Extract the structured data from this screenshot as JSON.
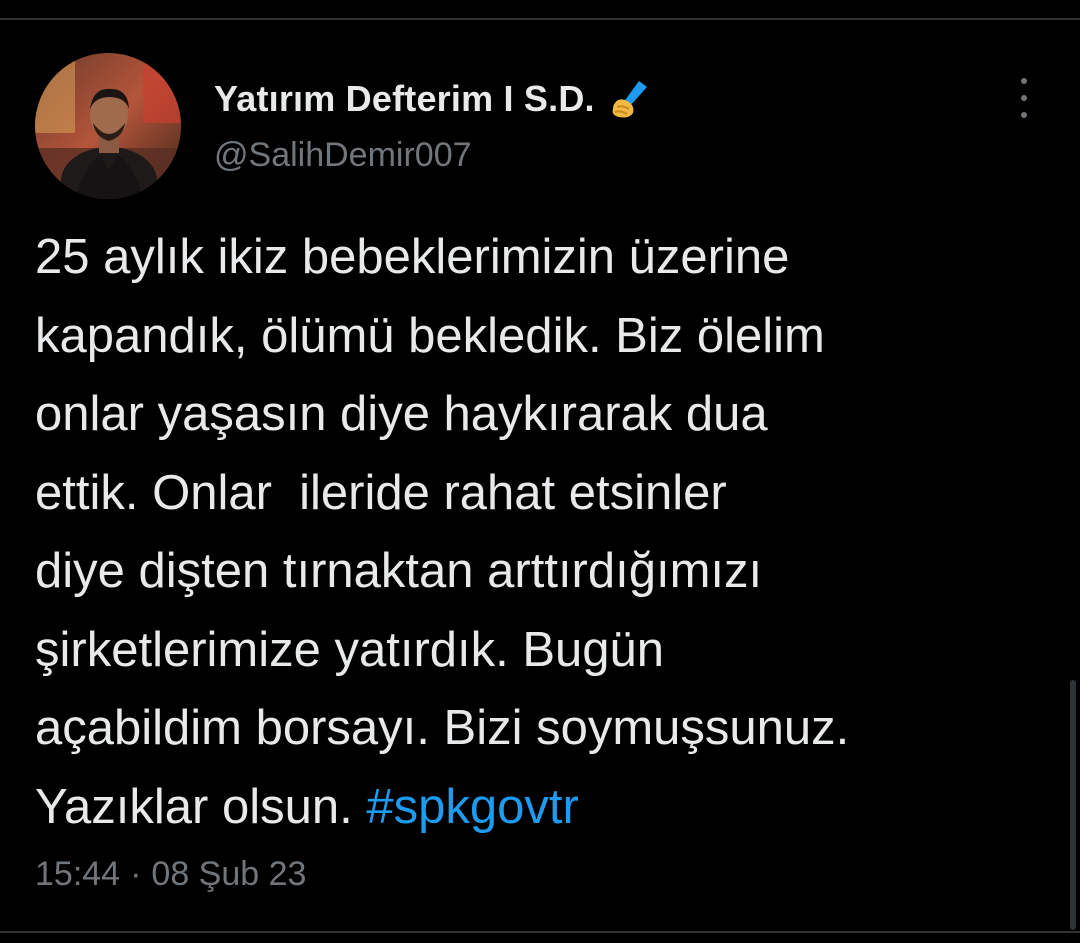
{
  "tweet": {
    "author": {
      "display_name": "Yatırım Defterim I S.D.",
      "handle": "@SalihDemir007",
      "name_emoji_icon": "writing-hand-icon",
      "avatar": "user-avatar-photo"
    },
    "more_icon": "more-vertical-icon",
    "body_lines": [
      "25 aylık ikiz bebeklerimizin üzerine",
      "kapandık, ölümü bekledik. Biz ölelim",
      "onlar yaşasın diye haykırarak dua",
      "ettik. Onlar  ileride rahat etsinler",
      "diye dişten tırnaktan arttırdığımızı",
      "şirketlerimize yatırdık. Bugün",
      "açabildim borsayı. Bizi soymuşsunuz.",
      "Yazıklar olsun. "
    ],
    "hashtag": "#spkgovtr",
    "time": "15:44",
    "separator": "·",
    "date": "08 Şub 23"
  },
  "colors": {
    "background": "#000000",
    "text_primary": "#e7e9ea",
    "text_secondary": "#71767b",
    "link": "#1d9bf0",
    "divider": "#2f3336"
  }
}
